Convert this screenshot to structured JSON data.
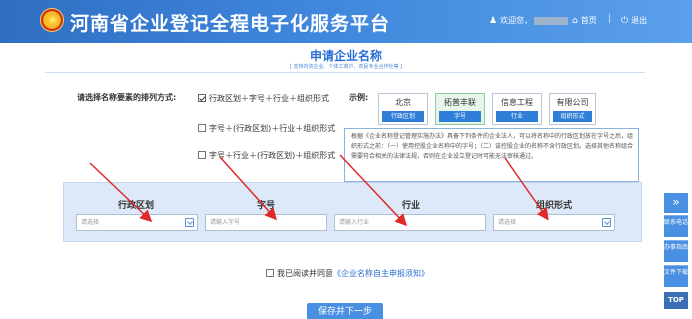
{
  "header": {
    "site_title": "河南省企业登记全程电子化服务平台",
    "welcome": "欢迎您，",
    "home": "首页",
    "separator": "|",
    "logout": "退出"
  },
  "page": {
    "title": "申请企业名称",
    "subtitle": "[ 支持内资企业、个体工商户、农民专业合作社等 ]"
  },
  "arrangement": {
    "question": "请选择名称要素的排列方式:",
    "options": [
      {
        "label": "行政区划＋字号＋行业＋组织形式",
        "checked": true
      },
      {
        "label": "字号＋(行政区划)＋行业＋组织形式",
        "checked": false
      },
      {
        "label": "字号＋行业＋(行政区划)＋组织形式",
        "checked": false
      }
    ]
  },
  "example": {
    "label": "示例:",
    "boxes": [
      {
        "top": "北京",
        "bottom": "行政区划"
      },
      {
        "top": "拓普丰联",
        "bottom": "字号"
      },
      {
        "top": "信息工程",
        "bottom": "行业"
      },
      {
        "top": "有限公司",
        "bottom": "组织形式"
      }
    ],
    "note": "根据《企业名称登记管理实施办法》具备下列条件的企业法人，可以将名称中的行政区划放在字号之后，组织形式之前：（一）使用控股企业名称中的字号；（二）该控股企业的名称不含行政区划。选择其他名称组合需要符合相关的法律法规，否则在企业设立登记时可能无法审核通过。"
  },
  "fields": [
    {
      "label": "行政区划",
      "placeholder": "请选择"
    },
    {
      "label": "字号",
      "placeholder": "请输入字号"
    },
    {
      "label": "行业",
      "placeholder": "请输入行业"
    },
    {
      "label": "组织形式",
      "placeholder": "请选择"
    }
  ],
  "agree": {
    "text": "我已阅读并同意",
    "link": "《企业名称自主申报须知》"
  },
  "save_button": "保存并下一步",
  "sidebar": {
    "arrow": "»",
    "items": [
      "联系电话",
      "办事指南",
      "文件下载"
    ],
    "top": "TOP"
  },
  "colors": {
    "header": "#3f86dc",
    "accent": "#2a6fd4",
    "annotation_arrow": "#e02a2a"
  }
}
